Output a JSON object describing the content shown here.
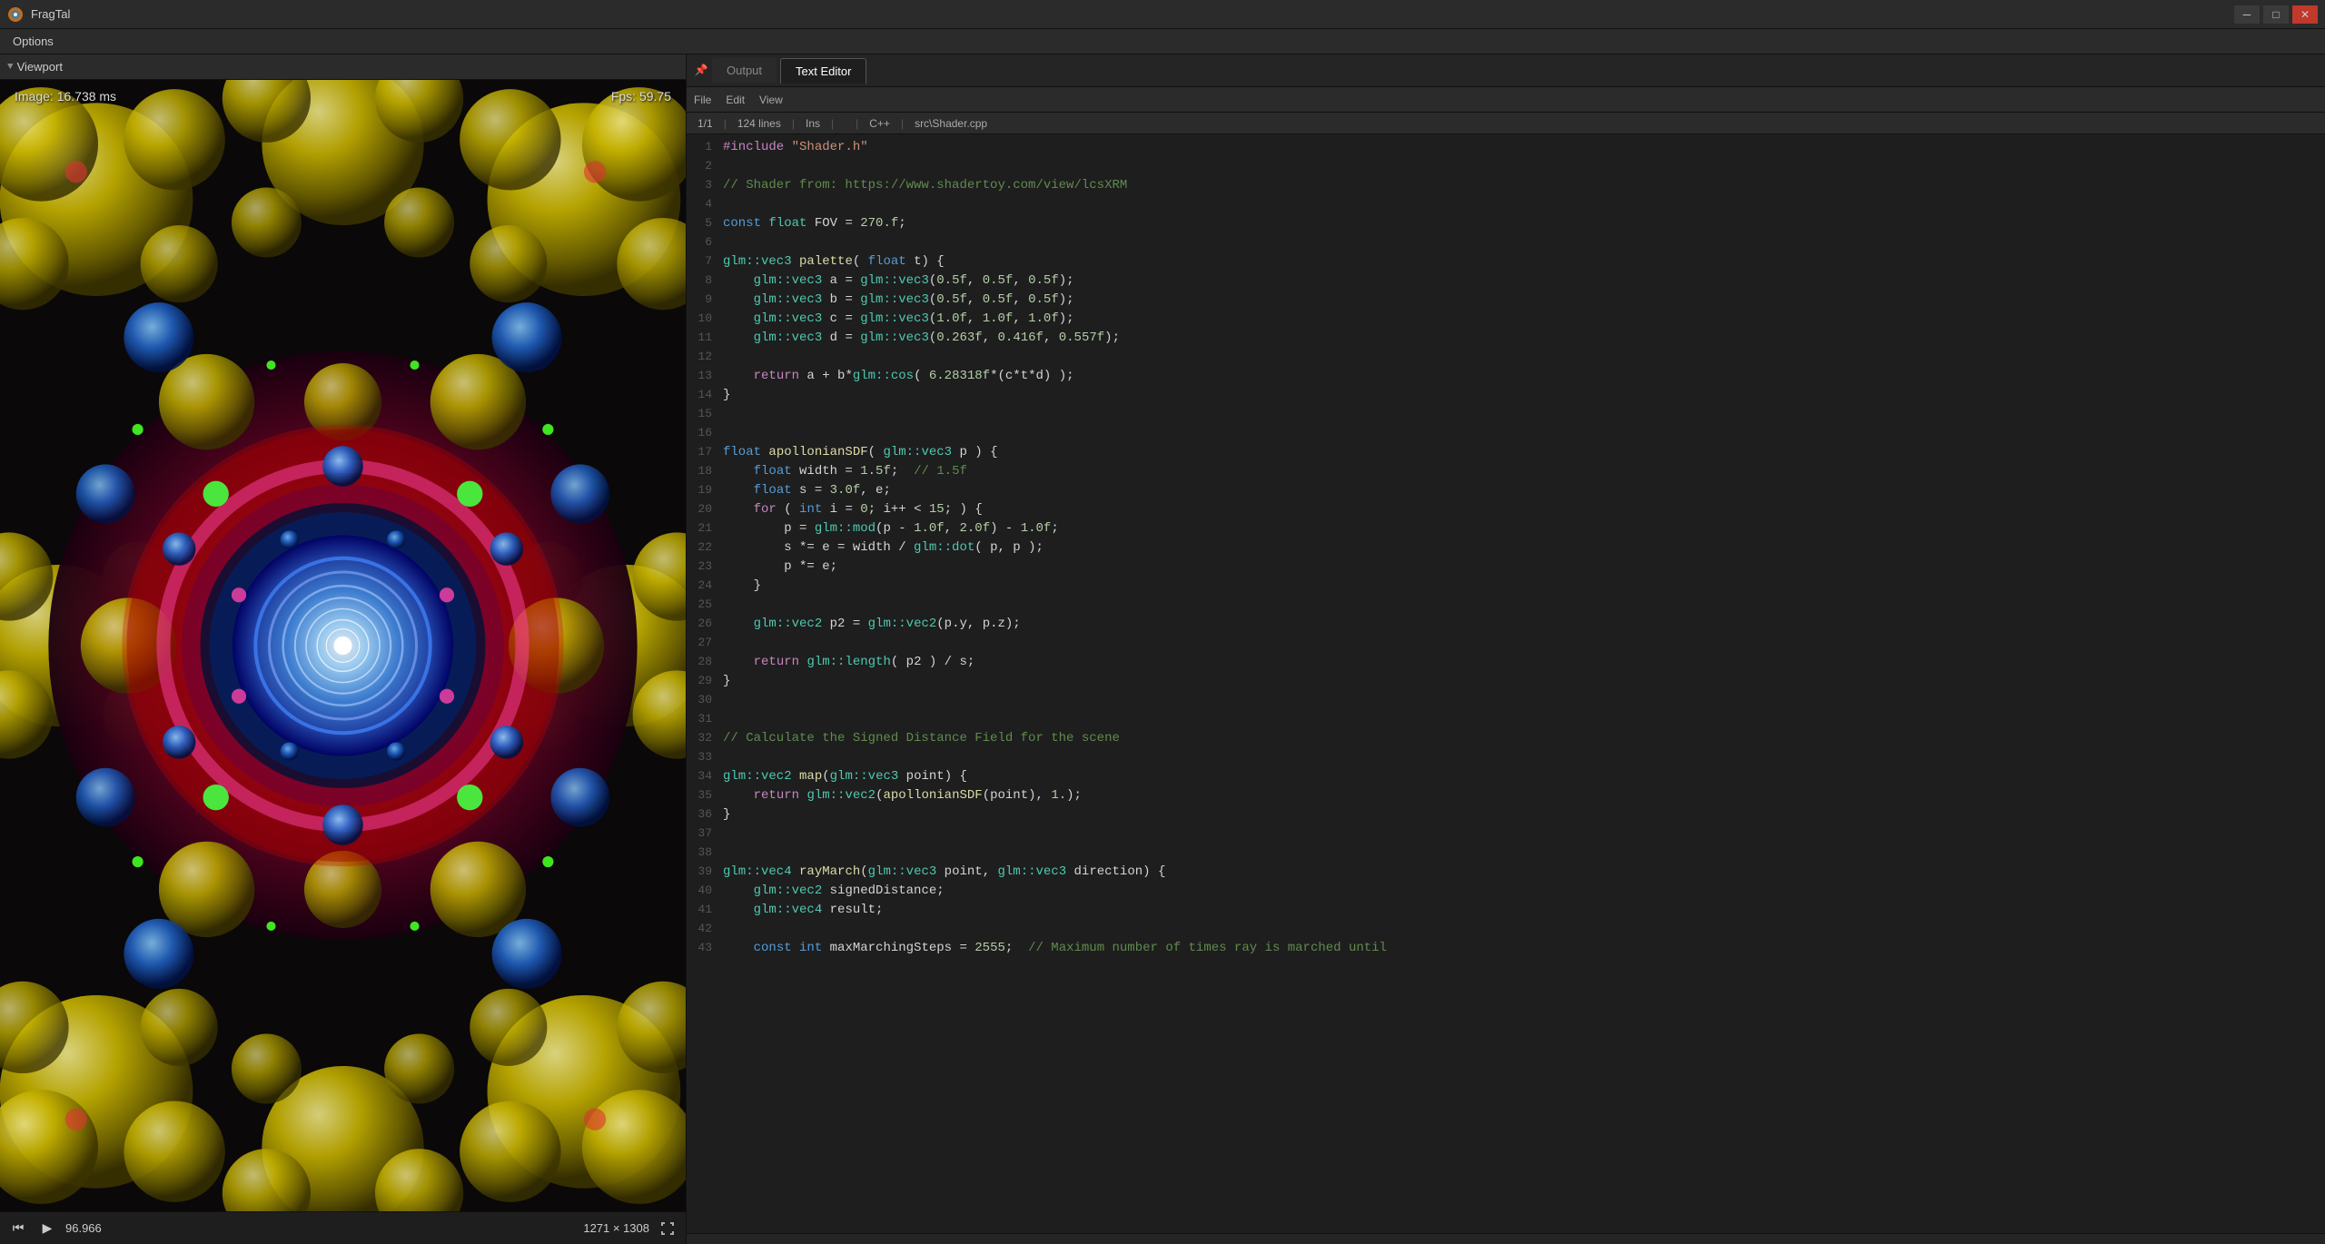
{
  "titlebar": {
    "app_name": "FragTal",
    "minimize_label": "─",
    "maximize_label": "□",
    "close_label": "✕"
  },
  "menubar": {
    "items": [
      "Options"
    ]
  },
  "viewport": {
    "label": "Viewport",
    "image_time": "Image: 16.738 ms",
    "fps": "Fps: 59.75",
    "time_value": "96.966",
    "resolution": "1271 × 1308"
  },
  "editor": {
    "tabs": [
      {
        "label": "Output",
        "active": false
      },
      {
        "label": "Text Editor",
        "active": true
      }
    ],
    "toolbar": {
      "file": "File",
      "edit": "Edit",
      "view": "View"
    },
    "status": {
      "position": "1/1",
      "lines": "124 lines",
      "sep1": "|",
      "ins": "Ins",
      "sep2": "|",
      "lang": "C++",
      "sep3": "|",
      "file": "src\\Shader.cpp"
    },
    "code_lines": [
      {
        "num": 1,
        "tokens": [
          {
            "t": "macro",
            "v": "#include"
          },
          {
            "t": "str",
            "v": " \"Shader.h\""
          }
        ]
      },
      {
        "num": 2,
        "tokens": []
      },
      {
        "num": 3,
        "tokens": [
          {
            "t": "cmt",
            "v": "// Shader from: https://www.shadertoy.com/view/lcsXRM"
          }
        ]
      },
      {
        "num": 4,
        "tokens": []
      },
      {
        "num": 5,
        "tokens": [
          {
            "t": "kw",
            "v": "const"
          },
          {
            "t": "type",
            "v": " float"
          },
          {
            "t": "op",
            "v": " FOV = "
          },
          {
            "t": "num",
            "v": "270.f"
          },
          {
            "t": "op",
            "v": ";"
          }
        ]
      },
      {
        "num": 6,
        "tokens": []
      },
      {
        "num": 7,
        "tokens": [
          {
            "t": "ns",
            "v": "glm::vec3"
          },
          {
            "t": "op",
            "v": " "
          },
          {
            "t": "fn",
            "v": "palette"
          },
          {
            "t": "op",
            "v": "( "
          },
          {
            "t": "kw",
            "v": "float"
          },
          {
            "t": "op",
            "v": " t) {"
          }
        ]
      },
      {
        "num": 8,
        "tokens": [
          {
            "t": "op",
            "v": "    "
          },
          {
            "t": "ns",
            "v": "glm::vec3"
          },
          {
            "t": "op",
            "v": " a = "
          },
          {
            "t": "ns",
            "v": "glm::vec3"
          },
          {
            "t": "op",
            "v": "("
          },
          {
            "t": "num",
            "v": "0.5f"
          },
          {
            "t": "op",
            "v": ", "
          },
          {
            "t": "num",
            "v": "0.5f"
          },
          {
            "t": "op",
            "v": ", "
          },
          {
            "t": "num",
            "v": "0.5f"
          },
          {
            "t": "op",
            "v": ");"
          }
        ]
      },
      {
        "num": 9,
        "tokens": [
          {
            "t": "op",
            "v": "    "
          },
          {
            "t": "ns",
            "v": "glm::vec3"
          },
          {
            "t": "op",
            "v": " b = "
          },
          {
            "t": "ns",
            "v": "glm::vec3"
          },
          {
            "t": "op",
            "v": "("
          },
          {
            "t": "num",
            "v": "0.5f"
          },
          {
            "t": "op",
            "v": ", "
          },
          {
            "t": "num",
            "v": "0.5f"
          },
          {
            "t": "op",
            "v": ", "
          },
          {
            "t": "num",
            "v": "0.5f"
          },
          {
            "t": "op",
            "v": ");"
          }
        ]
      },
      {
        "num": 10,
        "tokens": [
          {
            "t": "op",
            "v": "    "
          },
          {
            "t": "ns",
            "v": "glm::vec3"
          },
          {
            "t": "op",
            "v": " c = "
          },
          {
            "t": "ns",
            "v": "glm::vec3"
          },
          {
            "t": "op",
            "v": "("
          },
          {
            "t": "num",
            "v": "1.0f"
          },
          {
            "t": "op",
            "v": ", "
          },
          {
            "t": "num",
            "v": "1.0f"
          },
          {
            "t": "op",
            "v": ", "
          },
          {
            "t": "num",
            "v": "1.0f"
          },
          {
            "t": "op",
            "v": ");"
          }
        ]
      },
      {
        "num": 11,
        "tokens": [
          {
            "t": "op",
            "v": "    "
          },
          {
            "t": "ns",
            "v": "glm::vec3"
          },
          {
            "t": "op",
            "v": " d = "
          },
          {
            "t": "ns",
            "v": "glm::vec3"
          },
          {
            "t": "op",
            "v": "("
          },
          {
            "t": "num",
            "v": "0.263f"
          },
          {
            "t": "op",
            "v": ", "
          },
          {
            "t": "num",
            "v": "0.416f"
          },
          {
            "t": "op",
            "v": ", "
          },
          {
            "t": "num",
            "v": "0.557f"
          },
          {
            "t": "op",
            "v": ");"
          }
        ]
      },
      {
        "num": 12,
        "tokens": []
      },
      {
        "num": 13,
        "tokens": [
          {
            "t": "op",
            "v": "    "
          },
          {
            "t": "kw2",
            "v": "return"
          },
          {
            "t": "op",
            "v": " a + b*"
          },
          {
            "t": "ns",
            "v": "glm::cos"
          },
          {
            "t": "op",
            "v": "( "
          },
          {
            "t": "num",
            "v": "6.28318f"
          },
          {
            "t": "op",
            "v": "*(c*t*d) );"
          }
        ]
      },
      {
        "num": 14,
        "tokens": [
          {
            "t": "op",
            "v": "}"
          }
        ]
      },
      {
        "num": 15,
        "tokens": []
      },
      {
        "num": 16,
        "tokens": []
      },
      {
        "num": 17,
        "tokens": [
          {
            "t": "kw",
            "v": "float"
          },
          {
            "t": "op",
            "v": " "
          },
          {
            "t": "fn",
            "v": "apollonianSDF"
          },
          {
            "t": "op",
            "v": "( "
          },
          {
            "t": "ns",
            "v": "glm::vec3"
          },
          {
            "t": "op",
            "v": " p ) {"
          }
        ]
      },
      {
        "num": 18,
        "tokens": [
          {
            "t": "op",
            "v": "    "
          },
          {
            "t": "kw",
            "v": "float"
          },
          {
            "t": "op",
            "v": " width = "
          },
          {
            "t": "num",
            "v": "1.5f"
          },
          {
            "t": "op",
            "v": ";  "
          },
          {
            "t": "cmt",
            "v": "// 1.5f"
          }
        ]
      },
      {
        "num": 19,
        "tokens": [
          {
            "t": "op",
            "v": "    "
          },
          {
            "t": "kw",
            "v": "float"
          },
          {
            "t": "op",
            "v": " s = "
          },
          {
            "t": "num",
            "v": "3.0f"
          },
          {
            "t": "op",
            "v": ", e;"
          }
        ]
      },
      {
        "num": 20,
        "tokens": [
          {
            "t": "op",
            "v": "    "
          },
          {
            "t": "kw2",
            "v": "for"
          },
          {
            "t": "op",
            "v": " ( "
          },
          {
            "t": "kw",
            "v": "int"
          },
          {
            "t": "op",
            "v": " i = "
          },
          {
            "t": "num",
            "v": "0"
          },
          {
            "t": "op",
            "v": "; i++ < "
          },
          {
            "t": "num",
            "v": "15"
          },
          {
            "t": "op",
            "v": "; ) {"
          }
        ]
      },
      {
        "num": 21,
        "tokens": [
          {
            "t": "op",
            "v": "        p = "
          },
          {
            "t": "ns",
            "v": "glm::mod"
          },
          {
            "t": "op",
            "v": "(p - "
          },
          {
            "t": "num",
            "v": "1.0f"
          },
          {
            "t": "op",
            "v": ", "
          },
          {
            "t": "num",
            "v": "2.0f"
          },
          {
            "t": "op",
            "v": ") - "
          },
          {
            "t": "num",
            "v": "1.0f"
          },
          {
            "t": "op",
            "v": ";"
          }
        ]
      },
      {
        "num": 22,
        "tokens": [
          {
            "t": "op",
            "v": "        s *= e = width / "
          },
          {
            "t": "ns",
            "v": "glm::dot"
          },
          {
            "t": "op",
            "v": "( p, p );"
          }
        ]
      },
      {
        "num": 23,
        "tokens": [
          {
            "t": "op",
            "v": "        p *= e;"
          }
        ]
      },
      {
        "num": 24,
        "tokens": [
          {
            "t": "op",
            "v": "    }"
          }
        ]
      },
      {
        "num": 25,
        "tokens": []
      },
      {
        "num": 26,
        "tokens": [
          {
            "t": "op",
            "v": "    "
          },
          {
            "t": "ns",
            "v": "glm::vec2"
          },
          {
            "t": "op",
            "v": " p2 = "
          },
          {
            "t": "ns",
            "v": "glm::vec2"
          },
          {
            "t": "op",
            "v": "(p.y, p.z);"
          }
        ]
      },
      {
        "num": 27,
        "tokens": []
      },
      {
        "num": 28,
        "tokens": [
          {
            "t": "op",
            "v": "    "
          },
          {
            "t": "kw2",
            "v": "return"
          },
          {
            "t": "op",
            "v": " "
          },
          {
            "t": "ns",
            "v": "glm::length"
          },
          {
            "t": "op",
            "v": "( p2 ) / s;"
          }
        ]
      },
      {
        "num": 29,
        "tokens": [
          {
            "t": "op",
            "v": "}"
          }
        ]
      },
      {
        "num": 30,
        "tokens": []
      },
      {
        "num": 31,
        "tokens": []
      },
      {
        "num": 32,
        "tokens": [
          {
            "t": "cmt",
            "v": "// Calculate the Signed Distance Field for the scene"
          }
        ]
      },
      {
        "num": 33,
        "tokens": []
      },
      {
        "num": 34,
        "tokens": [
          {
            "t": "ns",
            "v": "glm::vec2"
          },
          {
            "t": "op",
            "v": " "
          },
          {
            "t": "fn",
            "v": "map"
          },
          {
            "t": "op",
            "v": "("
          },
          {
            "t": "ns",
            "v": "glm::vec3"
          },
          {
            "t": "op",
            "v": " point) {"
          }
        ]
      },
      {
        "num": 35,
        "tokens": [
          {
            "t": "op",
            "v": "    "
          },
          {
            "t": "kw2",
            "v": "return"
          },
          {
            "t": "op",
            "v": " "
          },
          {
            "t": "ns",
            "v": "glm::vec2"
          },
          {
            "t": "op",
            "v": "("
          },
          {
            "t": "fn",
            "v": "apollonianSDF"
          },
          {
            "t": "op",
            "v": "(point), "
          },
          {
            "t": "num",
            "v": "1."
          },
          {
            "t": "op",
            "v": ");"
          }
        ]
      },
      {
        "num": 36,
        "tokens": [
          {
            "t": "op",
            "v": "}"
          }
        ]
      },
      {
        "num": 37,
        "tokens": []
      },
      {
        "num": 38,
        "tokens": []
      },
      {
        "num": 39,
        "tokens": [
          {
            "t": "ns",
            "v": "glm::vec4"
          },
          {
            "t": "op",
            "v": " "
          },
          {
            "t": "fn",
            "v": "rayMarch"
          },
          {
            "t": "op",
            "v": "("
          },
          {
            "t": "ns",
            "v": "glm::vec3"
          },
          {
            "t": "op",
            "v": " point, "
          },
          {
            "t": "ns",
            "v": "glm::vec3"
          },
          {
            "t": "op",
            "v": " direction) {"
          }
        ]
      },
      {
        "num": 40,
        "tokens": [
          {
            "t": "op",
            "v": "    "
          },
          {
            "t": "ns",
            "v": "glm::vec2"
          },
          {
            "t": "op",
            "v": " signedDistance;"
          }
        ]
      },
      {
        "num": 41,
        "tokens": [
          {
            "t": "op",
            "v": "    "
          },
          {
            "t": "ns",
            "v": "glm::vec4"
          },
          {
            "t": "op",
            "v": " result;"
          }
        ]
      },
      {
        "num": 42,
        "tokens": []
      },
      {
        "num": 43,
        "tokens": [
          {
            "t": "op",
            "v": "    "
          },
          {
            "t": "kw",
            "v": "const int"
          },
          {
            "t": "op",
            "v": " maxMarchingSteps = "
          },
          {
            "t": "num",
            "v": "2555"
          },
          {
            "t": "op",
            "v": ";  "
          },
          {
            "t": "cmt",
            "v": "// Maximum number of times ray is marched until"
          }
        ]
      }
    ]
  }
}
